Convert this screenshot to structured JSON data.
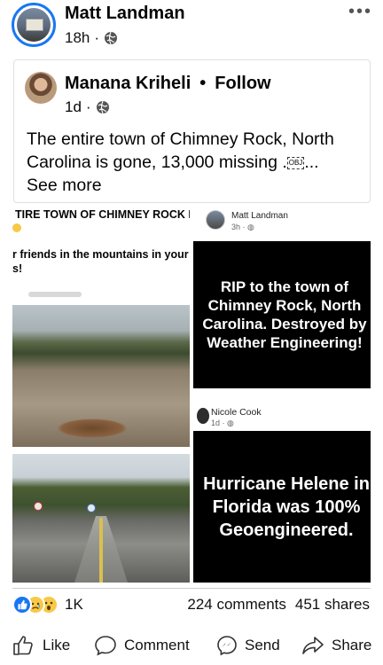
{
  "post": {
    "author": "Matt Landman",
    "time": "18h",
    "more": "•••"
  },
  "shared": {
    "author": "Manana Kriheli",
    "separator": "•",
    "follow": "Follow",
    "time": "1d",
    "text_main": "The entire town of Chimney Rock, North Carolina is gone, 13,000 missing .",
    "text_obj": "OBJ",
    "text_ellipsis": "...",
    "see_more": "See more"
  },
  "media": {
    "left_heading": "TIRE TOWN OF CHIMNEY ROCK N",
    "left_line1": "r friends in the mountains in your",
    "left_line2": "s!",
    "rt_name": "Matt Landman",
    "rt_meta": "3h · ",
    "rt_text": "RIP to the town of Chimney Rock, North Carolina. Destroyed by Weather Engineering!",
    "rb_name": "Nicole Cook",
    "rb_meta": "1d · ",
    "rb_text": "Hurricane Helene in Florida was 100% Geoengineered."
  },
  "engagement": {
    "reaction_count": "1K",
    "comments": "224 comments",
    "shares": "451 shares"
  },
  "actions": {
    "like": "Like",
    "comment": "Comment",
    "send": "Send",
    "share": "Share"
  },
  "colors": {
    "accent": "#1877f2",
    "like_reaction": "#1877f2",
    "emoji_yellow": "#f7c948",
    "divider": "#ccd0d5"
  },
  "icons": {
    "globe": "globe-icon",
    "like": "thumbs-up-icon",
    "comment": "comment-bubble-icon",
    "send": "messenger-icon",
    "share": "share-arrow-icon",
    "more": "more-dots-icon"
  }
}
